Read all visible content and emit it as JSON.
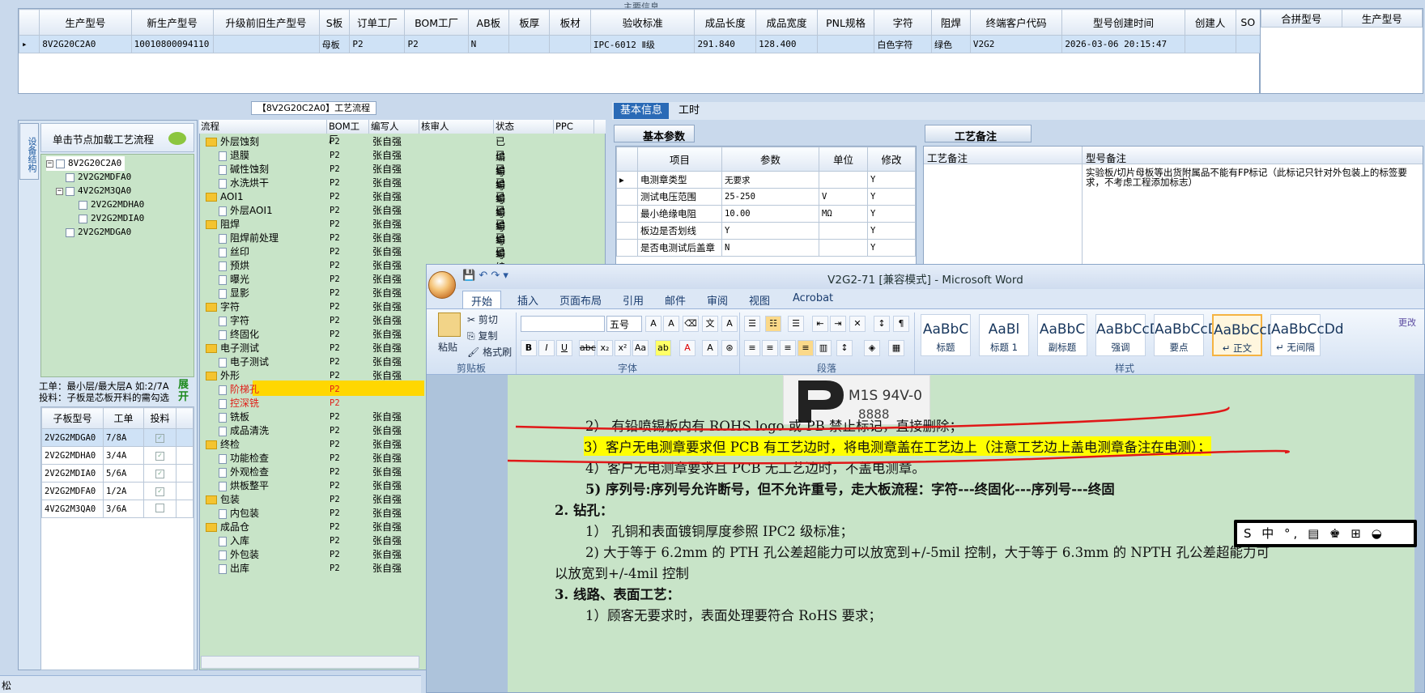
{
  "top_header_hint": "主要信息",
  "product_grid": {
    "columns": [
      "生产型号",
      "新生产型号",
      "升级前旧生产型号",
      "S板",
      "订单工厂",
      "BOM工厂",
      "AB板",
      "板厚",
      "板材",
      "验收标准",
      "成品长度",
      "成品宽度",
      "PNL规格",
      "字符",
      "阻焊",
      "终端客户代码",
      "型号创建时间",
      "创建人",
      "SO"
    ],
    "row": [
      "8V2G20C2A0",
      "10010800094110",
      "",
      "母板",
      "P2",
      "P2",
      "N",
      "",
      "",
      "IPC-6012 Ⅱ级",
      "291.840",
      "128.400",
      "",
      "白色字符",
      "绿色",
      "V2G2",
      "2026-03-06 20:15:47",
      "",
      ""
    ]
  },
  "merge_grid": {
    "columns": [
      "合拼型号",
      "生产型号"
    ]
  },
  "left_panel": {
    "vertical_tab": "设备结构",
    "hint": "单击节点加载工艺流程",
    "tree": [
      "8V2G20C2A0",
      "2V2G2MDFA0",
      "4V2G2M3QA0",
      "2V2G2MDHA0",
      "2V2G2MDIA0",
      "2V2G2MDGA0"
    ],
    "info_line1": "工单：最小层/最大层A 如:2/7A",
    "info_line2": "投料：子板是芯板开料的需勾选",
    "expand": "展开",
    "sub_cols": [
      "子板型号",
      "工单",
      "投料"
    ],
    "sub_rows": [
      {
        "model": "2V2G2MDGA0",
        "order": "7/8A",
        "checked": "✓"
      },
      {
        "model": "2V2G2MDHA0",
        "order": "3/4A",
        "checked": "✓"
      },
      {
        "model": "2V2G2MDIA0",
        "order": "5/6A",
        "checked": "✓"
      },
      {
        "model": "2V2G2MDFA0",
        "order": "1/2A",
        "checked": "✓"
      },
      {
        "model": "4V2G2M3QA0",
        "order": "3/6A",
        "checked": ""
      }
    ]
  },
  "flow": {
    "title": "【8V2G20C2A0】工艺流程",
    "columns": [
      "流程",
      "BOM工厂",
      "编写人",
      "核审人",
      "状态",
      "PPC"
    ],
    "rows": [
      {
        "name": "外层蚀刻",
        "type": "folder",
        "bom": "P2",
        "author": "张自强",
        "status": "已编写"
      },
      {
        "name": "退膜",
        "type": "doc",
        "bom": "P2",
        "author": "张自强",
        "status": "已编写"
      },
      {
        "name": "碱性蚀刻",
        "type": "doc",
        "bom": "P2",
        "author": "张自强",
        "status": "已编写"
      },
      {
        "name": "水洗烘干",
        "type": "doc",
        "bom": "P2",
        "author": "张自强",
        "status": "已编写"
      },
      {
        "name": "AOI1",
        "type": "folder",
        "bom": "P2",
        "author": "张自强",
        "status": "已编写"
      },
      {
        "name": "外层AOI1",
        "type": "doc",
        "bom": "P2",
        "author": "张自强",
        "status": "已编写"
      },
      {
        "name": "阻焊",
        "type": "folder",
        "bom": "P2",
        "author": "张自强",
        "status": "已编写"
      },
      {
        "name": "阻焊前处理",
        "type": "doc",
        "bom": "P2",
        "author": "张自强",
        "status": "已编写"
      },
      {
        "name": "丝印",
        "type": "doc",
        "bom": "P2",
        "author": "张自强",
        "status": "已编写"
      },
      {
        "name": "预烘",
        "type": "doc",
        "bom": "P2",
        "author": "张自强",
        "status": ""
      },
      {
        "name": "曝光",
        "type": "doc",
        "bom": "P2",
        "author": "张自强",
        "status": ""
      },
      {
        "name": "显影",
        "type": "doc",
        "bom": "P2",
        "author": "张自强",
        "status": ""
      },
      {
        "name": "字符",
        "type": "folder",
        "bom": "P2",
        "author": "张自强",
        "status": ""
      },
      {
        "name": "字符",
        "type": "doc",
        "bom": "P2",
        "author": "张自强",
        "status": ""
      },
      {
        "name": "终固化",
        "type": "doc",
        "bom": "P2",
        "author": "张自强",
        "status": ""
      },
      {
        "name": "电子测试",
        "type": "folder",
        "bom": "P2",
        "author": "张自强",
        "status": ""
      },
      {
        "name": "电子测试",
        "type": "doc",
        "bom": "P2",
        "author": "张自强",
        "status": ""
      },
      {
        "name": "外形",
        "type": "folder",
        "bom": "P2",
        "author": "张自强",
        "status": ""
      },
      {
        "name": "阶梯孔",
        "type": "doc",
        "bom": "P2",
        "author": "",
        "status": "",
        "red": true
      },
      {
        "name": "控深铣",
        "type": "doc",
        "bom": "P2",
        "author": "",
        "status": "",
        "red": true
      },
      {
        "name": "铣板",
        "type": "doc",
        "bom": "P2",
        "author": "张自强",
        "status": ""
      },
      {
        "name": "成品清洗",
        "type": "doc",
        "bom": "P2",
        "author": "张自强",
        "status": ""
      },
      {
        "name": "终检",
        "type": "folder",
        "bom": "P2",
        "author": "张自强",
        "status": ""
      },
      {
        "name": "功能检查",
        "type": "doc",
        "bom": "P2",
        "author": "张自强",
        "status": ""
      },
      {
        "name": "外观检查",
        "type": "doc",
        "bom": "P2",
        "author": "张自强",
        "status": ""
      },
      {
        "name": "烘板整平",
        "type": "doc",
        "bom": "P2",
        "author": "张自强",
        "status": ""
      },
      {
        "name": "包装",
        "type": "folder",
        "bom": "P2",
        "author": "张自强",
        "status": ""
      },
      {
        "name": "内包装",
        "type": "doc",
        "bom": "P2",
        "author": "张自强",
        "status": ""
      },
      {
        "name": "成品仓",
        "type": "folder",
        "bom": "P2",
        "author": "张自强",
        "status": ""
      },
      {
        "name": "入库",
        "type": "doc",
        "bom": "P2",
        "author": "张自强",
        "status": ""
      },
      {
        "name": "外包装",
        "type": "doc",
        "bom": "P2",
        "author": "张自强",
        "status": ""
      },
      {
        "name": "出库",
        "type": "doc",
        "bom": "P2",
        "author": "张自强",
        "status": ""
      }
    ]
  },
  "right": {
    "tabs": [
      "基本信息",
      "工时"
    ],
    "basic_params_title": "基本参数",
    "param_cols": [
      "项目",
      "参数",
      "单位",
      "修改"
    ],
    "params": [
      {
        "item": "电测章类型",
        "value": "无要求",
        "unit": "",
        "edit": "Y"
      },
      {
        "item": "测试电压范围",
        "value": "25-250",
        "unit": "V",
        "edit": "Y"
      },
      {
        "item": "最小绝缘电阻",
        "value": "10.00",
        "unit": "MΩ",
        "edit": "Y"
      },
      {
        "item": "板边是否划线",
        "value": "Y",
        "unit": "",
        "edit": "Y"
      },
      {
        "item": "是否电测试后盖章",
        "value": "N",
        "unit": "",
        "edit": "Y"
      }
    ],
    "note_title": "工艺备注",
    "note_cols": [
      "工艺备注",
      "型号备注"
    ],
    "model_note": "实验板/切片母板等出货附属品不能有FP标记（此标记只针对外包装上的标签要求，不考虑工程添加标志）"
  },
  "word": {
    "title": "V2G2-71 [兼容模式] - Microsoft Word",
    "tabs": [
      "开始",
      "插入",
      "页面布局",
      "引用",
      "邮件",
      "审阅",
      "视图",
      "Acrobat"
    ],
    "clipboard": {
      "paste": "粘贴",
      "cut": "剪切",
      "copy": "复制",
      "painter": "格式刷",
      "label": "剪贴板"
    },
    "font": {
      "size": "五号",
      "label": "字体"
    },
    "paragraph_label": "段落",
    "styles": [
      {
        "preview": "AaBbC",
        "label": "标题"
      },
      {
        "preview": "AaBl",
        "label": "标题 1"
      },
      {
        "preview": "AaBbC",
        "label": "副标题"
      },
      {
        "preview": "AaBbCcDd",
        "label": "强调"
      },
      {
        "preview": "AaBbCcD",
        "label": "要点"
      },
      {
        "preview": "AaBbCcDd",
        "label": "↵ 正文"
      },
      {
        "preview": "AaBbCcDd",
        "label": "↵ 无间隔"
      }
    ],
    "styles_label": "样式",
    "change_style": "更改",
    "logo_text": "M1S 94V-0",
    "logo_sub": "8888",
    "lines": [
      "2） 有铅喷锡板内有 ROHS logo 或 PB 禁止标记，直接删除；",
      "3）客户无电测章要求但 PCB 有工艺边时，将电测章盖在工艺边上（注意工艺边上盖电测章备注在电测）；",
      "4）客户无电测章要求且 PCB 无工艺边时，不盖电测章。",
      "5) 序列号:序列号允许断号，但不允许重号，走大板流程：字符---终固化---序列号---终固",
      "2.    钻孔：",
      "1）  孔铜和表面镀铜厚度参照 IPC2 级标准；",
      "2)  大于等于 6.2mm 的 PTH 孔公差超能力可以放宽到+/-5mil 控制，大于等于 6.3mm 的 NPTH 孔公差超能力可",
      "以放宽到+/-4mil 控制",
      "3.    线路、表面工艺：",
      "1）顾客无要求时，表面处理要符合 RoHS 要求；"
    ]
  },
  "ime": "S 中 °, ▤ ♚ ⊞ ◒",
  "status_text": "松",
  "colors": {
    "highlight": "#ffff00",
    "accent": "#2a6ab6",
    "tree_green": "#c8e4c8"
  }
}
